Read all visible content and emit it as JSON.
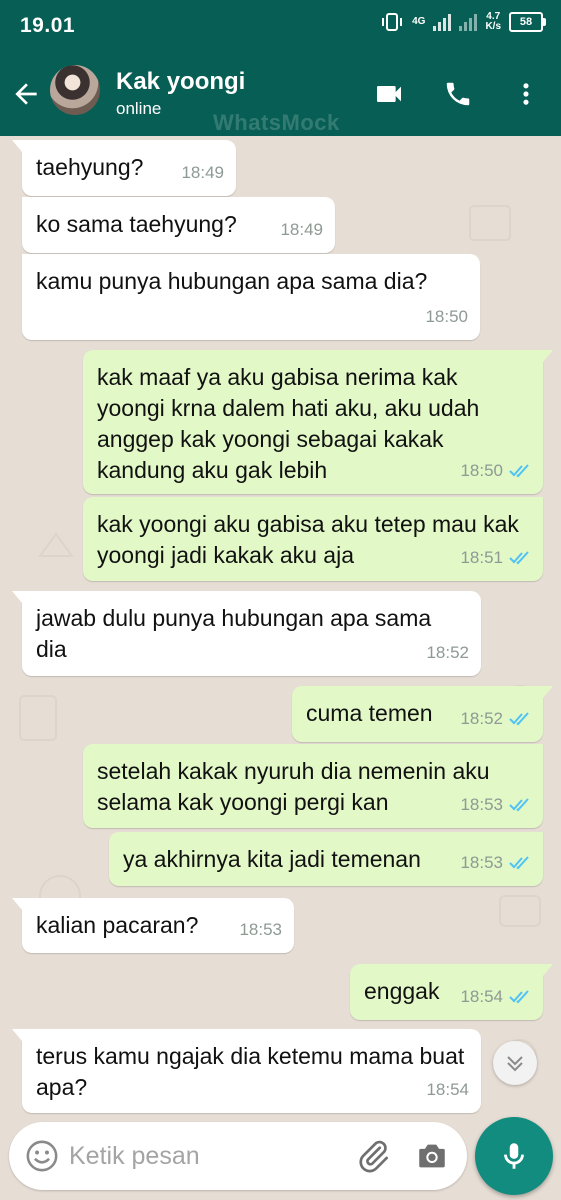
{
  "status_bar": {
    "time": "19.01",
    "network": "4G",
    "speed_value": "4.7",
    "speed_unit": "K/s",
    "battery": "58"
  },
  "header": {
    "name": "Kak yoongi",
    "status": "online",
    "watermark": "WhatsMock"
  },
  "messages": [
    {
      "dir": "in",
      "text": "taehyung?",
      "time": "18:49"
    },
    {
      "dir": "in",
      "text": "ko sama taehyung?",
      "time": "18:49"
    },
    {
      "dir": "in",
      "text": "kamu punya hubungan apa sama dia?",
      "time": "18:50"
    },
    {
      "dir": "out",
      "text": "kak maaf ya aku gabisa nerima kak yoongi krna dalem hati aku, aku udah anggep kak yoongi sebagai kakak kandung aku gak lebih",
      "time": "18:50"
    },
    {
      "dir": "out",
      "text": "kak yoongi aku gabisa aku tetep mau kak yoongi jadi kakak aku aja",
      "time": "18:51"
    },
    {
      "dir": "in",
      "text": "jawab dulu punya hubungan apa sama dia",
      "time": "18:52"
    },
    {
      "dir": "out",
      "text": "cuma temen",
      "time": "18:52"
    },
    {
      "dir": "out",
      "text": "setelah kakak nyuruh dia nemenin aku selama kak yoongi pergi kan",
      "time": "18:53"
    },
    {
      "dir": "out",
      "text": "ya akhirnya kita jadi temenan",
      "time": "18:53"
    },
    {
      "dir": "in",
      "text": "kalian pacaran?",
      "time": "18:53"
    },
    {
      "dir": "out",
      "text": "enggak",
      "time": "18:54"
    },
    {
      "dir": "in",
      "text": "terus kamu ngajak dia ketemu mama buat apa?",
      "time": "18:54"
    }
  ],
  "composer": {
    "placeholder": "Ketik pesan"
  },
  "colors": {
    "header": "#075e54",
    "outgoing_bubble": "#e2f8c7",
    "incoming_bubble": "#ffffff",
    "read_tick": "#4fc3f7",
    "fab": "#128c7e",
    "chat_bg": "#e6ddd4"
  }
}
